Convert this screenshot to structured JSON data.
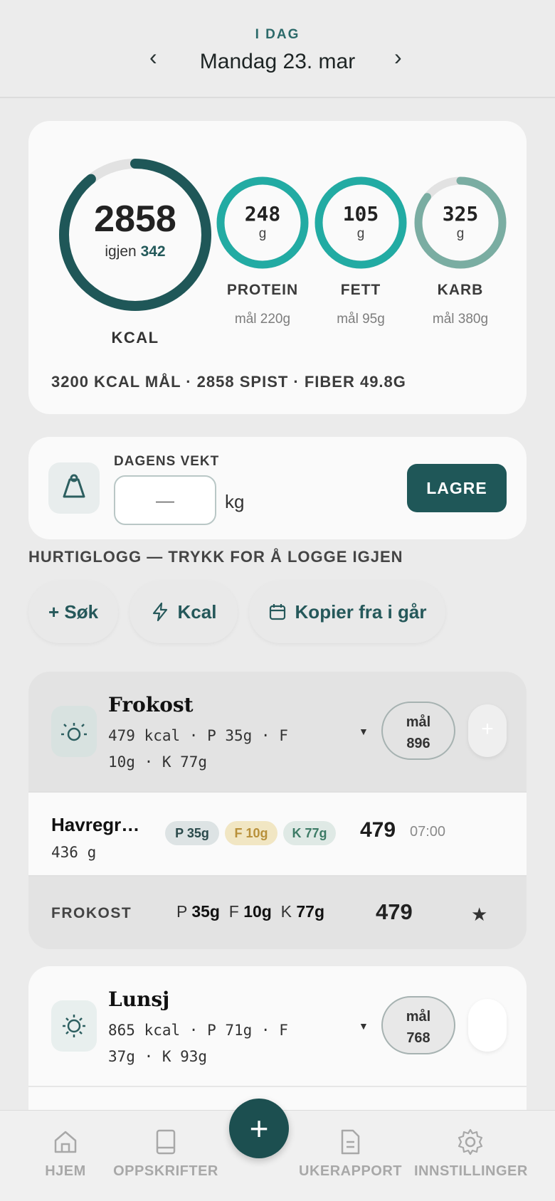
{
  "header": {
    "eyebrow": "I DAG",
    "date": "Mandag 23. mar",
    "prev_icon": "chevron-left-icon",
    "next_icon": "chevron-right-icon"
  },
  "summary": {
    "calories": "2858",
    "remaining_label": "igjen",
    "remaining_value": "342",
    "calories_unit": "KCAL",
    "calorie_progress": 0.893,
    "macros": [
      {
        "value": "248",
        "unit": "g",
        "name": "PROTEIN",
        "goal": "mål 220g",
        "progress": 1.0,
        "color": "#22aba3"
      },
      {
        "value": "105",
        "unit": "g",
        "name": "FETT",
        "goal": "mål 95g",
        "progress": 1.0,
        "color": "#22aba3"
      },
      {
        "value": "325",
        "unit": "g",
        "name": "KARB",
        "goal": "mål 380g",
        "progress": 0.855,
        "color": "#7aada2"
      }
    ],
    "totals_line": "3200 KCAL MÅL · 2858 SPIST · FIBER 49.8G"
  },
  "weight": {
    "label": "DAGENS VEKT",
    "placeholder": "—",
    "unit": "kg",
    "save_label": "LAGRE"
  },
  "quick_log": {
    "title": "HURTIGLOGG — TRYKK FOR Å LOGGE IGJEN",
    "chips": [
      {
        "label": "+ Søk"
      },
      {
        "label": "Kcal"
      },
      {
        "label": "Kopier fra i går"
      }
    ]
  },
  "meals": [
    {
      "title": "Frokost",
      "line1": "479 kcal · P 35g · F",
      "line2": "10g · K 77g",
      "goal_label": "mål",
      "goal_value": "896",
      "items": [
        {
          "name": "Havregr…",
          "weight": "436 g",
          "tag_p": "P 35g",
          "tag_f": "F 10g",
          "tag_k": "K 77g",
          "kcal": "479",
          "time": "07:00"
        }
      ],
      "footer": {
        "label": "FROKOST",
        "p_prefix": "P",
        "p_value": "35g",
        "f_prefix": "F",
        "f_value": "10g",
        "k_prefix": "K",
        "k_value": "77g",
        "kcal": "479"
      }
    },
    {
      "title": "Lunsj",
      "line1": "865 kcal · P 71g · F",
      "line2": "37g · K 93g",
      "goal_label": "mål",
      "goal_value": "768"
    }
  ],
  "nav": {
    "home": "HJEM",
    "recipes": "OPPSKRIFTER",
    "add": "+",
    "weekly": "UKERAPPORT",
    "settings": "INNSTILLINGER"
  },
  "colors": {
    "accent": "#1f5758",
    "teal": "#22aba3",
    "karb": "#7aada2",
    "ring_dark": "#1f5758",
    "track": "#e2e2e2"
  }
}
